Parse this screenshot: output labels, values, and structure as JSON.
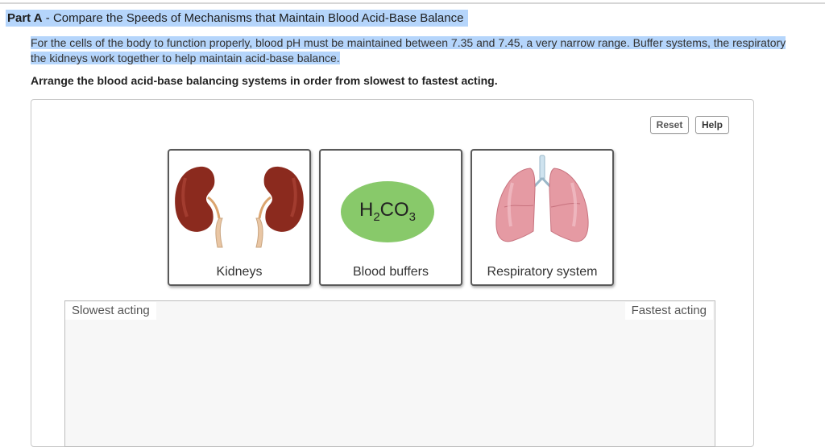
{
  "part": {
    "prefix": "Part A",
    "separator": " - ",
    "title": "Compare the Speeds of Mechanisms that Maintain Blood Acid-Base Balance"
  },
  "intro": {
    "line1": "For the cells of the body to function properly, blood pH must be maintained between 7.35 and 7.45, a very narrow range. Buffer systems, the respiratory",
    "line2": "the kidneys work together to help maintain acid-base balance."
  },
  "instruction": "Arrange the blood acid-base balancing systems in order from slowest to fastest acting.",
  "buttons": {
    "reset": "Reset",
    "help": "Help"
  },
  "cards": [
    {
      "label": "Kidneys",
      "icon": "kidneys-illustration"
    },
    {
      "label": "Blood buffers",
      "icon": "h2co3-ellipse",
      "formula": "H",
      "formula_sub1": "2",
      "formula_mid": "CO",
      "formula_sub2": "3"
    },
    {
      "label": "Respiratory system",
      "icon": "lungs-illustration"
    }
  ],
  "dropzone": {
    "left_label": "Slowest acting",
    "right_label": "Fastest acting"
  },
  "colors": {
    "highlight": "#b5d5fb",
    "buffer_green": "#88c96a",
    "kidney_red": "#8b2a1e"
  }
}
